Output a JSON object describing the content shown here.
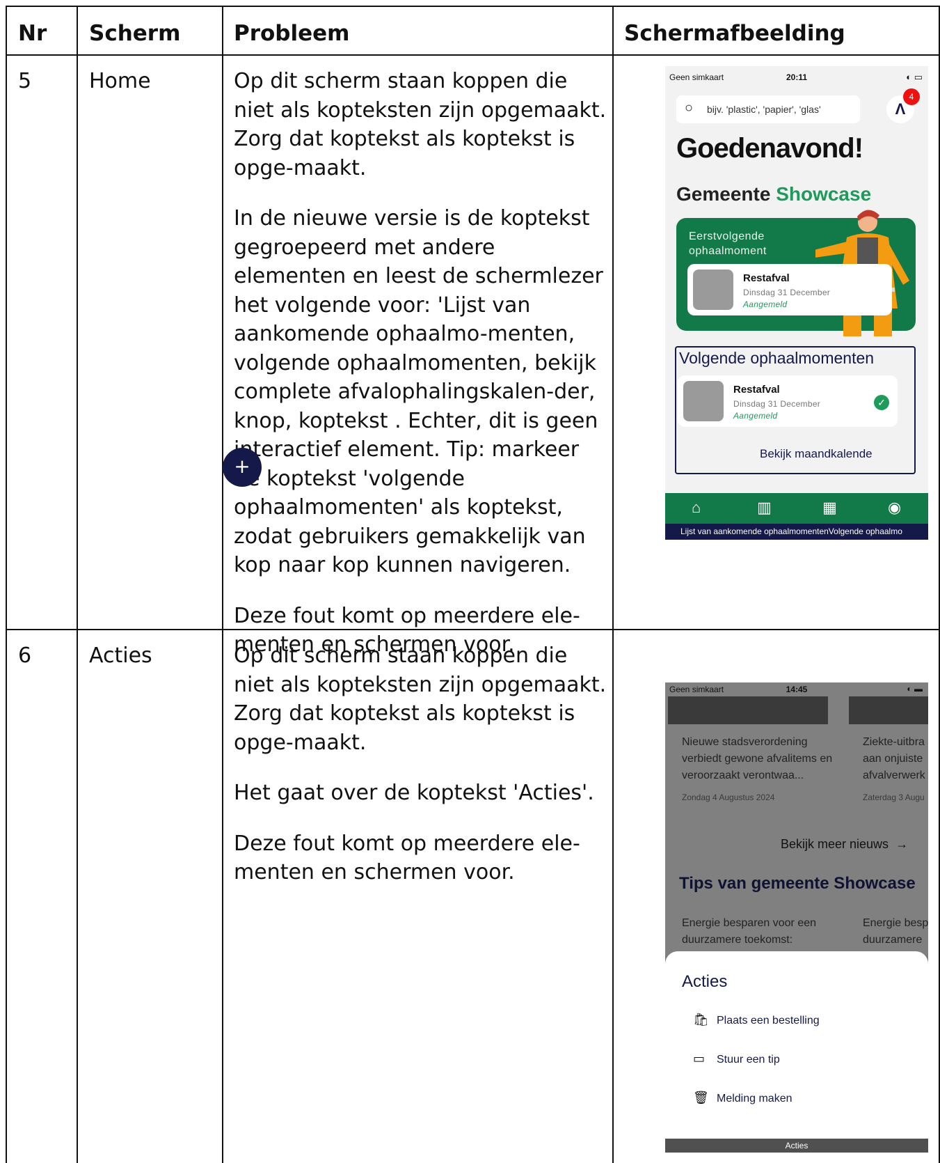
{
  "table": {
    "headers": [
      "Nr",
      "Scherm",
      "Probleem",
      "Schermafbeelding"
    ],
    "rows": [
      {
        "nr": "5",
        "scherm": "Home",
        "probleem": [
          "Op dit scherm staan koppen die niet als kopteksten zijn opgemaakt. Zorg dat koptekst als koptekst is opge-maakt.",
          "In de nieuwe versie is de koptekst gegroepeerd met andere elementen en leest de schermlezer het volgende voor: 'Lijst van aankomende ophaalmo-menten, volgende ophaalmomenten, bekijk complete afvalophalingskalen-der, knop, koptekst . Echter, dit is geen interactief element. Tip: markeer de koptekst 'volgende ophaalmomenten' als koptekst, zodat gebruikers gemakkelijk van kop naar kop kunnen navigeren.",
          "Deze fout komt op meerdere ele-menten en schermen voor."
        ]
      },
      {
        "nr": "6",
        "scherm": "Acties",
        "probleem": [
          "Op dit scherm staan koppen die niet als kopteksten zijn opgemaakt. Zorg dat koptekst als koptekst is opge-maakt.",
          "Het gaat over de koptekst 'Acties'.",
          "Deze fout komt op meerdere ele-menten en schermen voor."
        ]
      }
    ]
  },
  "screen1": {
    "carrier": "Geen simkaart",
    "time": "20:11",
    "search_placeholder": "bijv. 'plastic', 'papier', 'glas'",
    "badge": "4",
    "greeting": "Goedenavond!",
    "gemeente": "Gemeente",
    "gemeente_name": "Showcase",
    "next_label": "Eerstvolgende ophaalmoment",
    "next_item": {
      "name": "Restafval",
      "date": "Dinsdag 31 December",
      "status": "Aangemeld"
    },
    "volgende_title": "Volgende ophaalmomenten",
    "volgende_item": {
      "name": "Restafval",
      "date": "Dinsdag 31 December",
      "status": "Aangemeld"
    },
    "calendar_link": "Bekijk maandkalende",
    "fab": "+",
    "caption": "Lijst van aankomende ophaalmomentenVolgende ophaalmo",
    "colors": {
      "green": "#127a48",
      "navy": "#15194a",
      "accent": "#1e9a5b"
    }
  },
  "screen2": {
    "carrier": "Geen simkaart",
    "time": "14:45",
    "news": [
      {
        "title": "Nieuwe stadsverordening verbiedt gewone afvalitems en veroorzaakt verontwaa...",
        "date": "Zondag 4 Augustus 2024"
      },
      {
        "title": "Ziekte-uitbra aan onjuiste afvalverwerk",
        "date": "Zaterdag 3 Augu"
      }
    ],
    "more_news": "Bekijk meer nieuws",
    "tips_title": "Tips van gemeente Showcase",
    "tips": [
      {
        "title": "Energie besparen voor een duurzamere toekomst:"
      },
      {
        "title": "Energie besp duurzamere"
      }
    ],
    "sheet_title": "Acties",
    "actions": [
      "Plaats een bestelling",
      "Stuur een tip",
      "Melding maken"
    ],
    "caption": "Acties"
  }
}
